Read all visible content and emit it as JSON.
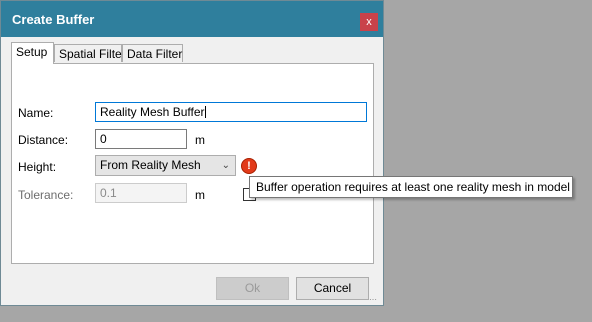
{
  "dialog": {
    "title": "Create Buffer",
    "close_glyph": "x"
  },
  "tabs": [
    {
      "label": "Setup",
      "active": true
    },
    {
      "label": "Spatial Filter",
      "active": false
    },
    {
      "label": "Data Filter",
      "active": false
    }
  ],
  "form": {
    "name_label": "Name:",
    "name_value": "Reality Mesh Buffer",
    "distance_label": "Distance:",
    "distance_value": "0",
    "distance_unit": "m",
    "height_label": "Height:",
    "height_value": "From Reality Mesh",
    "tolerance_label": "Tolerance:",
    "tolerance_value": "0.1",
    "tolerance_unit": "m"
  },
  "warning": {
    "icon": "error-icon",
    "glyph": "!",
    "tooltip": "Buffer operation requires at least one reality mesh in model"
  },
  "buttons": {
    "ok": "Ok",
    "cancel": "Cancel"
  },
  "colors": {
    "titlebar": "#2f7f9d",
    "close": "#c9424a",
    "warning": "#e23a1a"
  }
}
